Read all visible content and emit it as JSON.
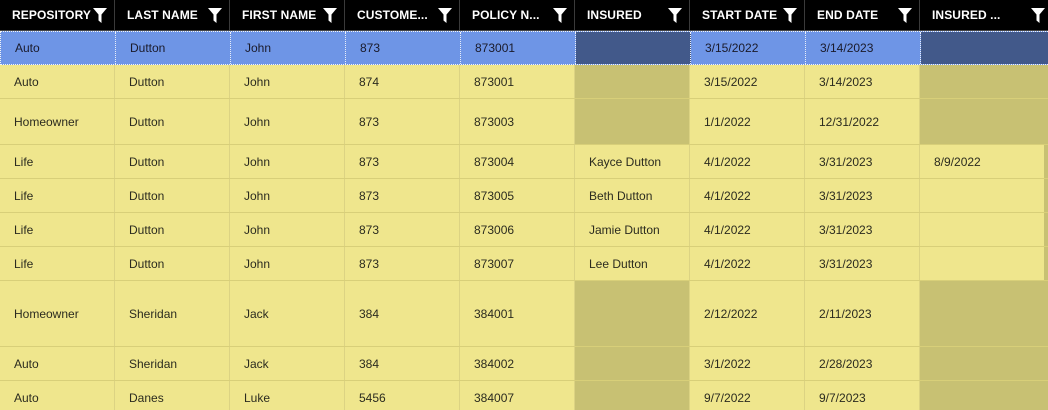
{
  "columns": [
    {
      "label": "REPOSITORY"
    },
    {
      "label": "LAST NAME"
    },
    {
      "label": "FIRST NAME"
    },
    {
      "label": "CUSTOME..."
    },
    {
      "label": "POLICY N..."
    },
    {
      "label": "INSURED"
    },
    {
      "label": "START DATE"
    },
    {
      "label": "END DATE"
    },
    {
      "label": "INSURED ..."
    }
  ],
  "rows": [
    {
      "repository": "Auto",
      "last_name": "Dutton",
      "first_name": "John",
      "customer": "873",
      "policy": "873001",
      "insured": "",
      "start": "3/15/2022",
      "end": "3/14/2023",
      "insured_date": ""
    },
    {
      "repository": "Auto",
      "last_name": "Dutton",
      "first_name": "John",
      "customer": "874",
      "policy": "873001",
      "insured": "",
      "start": "3/15/2022",
      "end": "3/14/2023",
      "insured_date": ""
    },
    {
      "repository": "Homeowner",
      "last_name": "Dutton",
      "first_name": "John",
      "customer": "873",
      "policy": "873003",
      "insured": "",
      "start": "1/1/2022",
      "end": "12/31/2022",
      "insured_date": ""
    },
    {
      "repository": "Life",
      "last_name": "Dutton",
      "first_name": "John",
      "customer": "873",
      "policy": "873004",
      "insured": "Kayce Dutton",
      "start": "4/1/2022",
      "end": "3/31/2023",
      "insured_date": "8/9/2022"
    },
    {
      "repository": "Life",
      "last_name": "Dutton",
      "first_name": "John",
      "customer": "873",
      "policy": "873005",
      "insured": "Beth Dutton",
      "start": "4/1/2022",
      "end": "3/31/2023",
      "insured_date": ""
    },
    {
      "repository": "Life",
      "last_name": "Dutton",
      "first_name": "John",
      "customer": "873",
      "policy": "873006",
      "insured": "Jamie Dutton",
      "start": "4/1/2022",
      "end": "3/31/2023",
      "insured_date": ""
    },
    {
      "repository": "Life",
      "last_name": "Dutton",
      "first_name": "John",
      "customer": "873",
      "policy": "873007",
      "insured": "Lee Dutton",
      "start": "4/1/2022",
      "end": "3/31/2023",
      "insured_date": ""
    },
    {
      "repository": "Homeowner",
      "last_name": "Sheridan",
      "first_name": "Jack",
      "customer": "384",
      "policy": "384001",
      "insured": "",
      "start": "2/12/2022",
      "end": "2/11/2023",
      "insured_date": ""
    },
    {
      "repository": "Auto",
      "last_name": "Sheridan",
      "first_name": "Jack",
      "customer": "384",
      "policy": "384002",
      "insured": "",
      "start": "3/1/2022",
      "end": "2/28/2023",
      "insured_date": ""
    },
    {
      "repository": "Auto",
      "last_name": "Danes",
      "first_name": "Luke",
      "customer": "5456",
      "policy": "384007",
      "insured": "",
      "start": "9/7/2022",
      "end": "9/7/2023",
      "insured_date": ""
    }
  ],
  "icons": {
    "filter": "filter-funnel-icon"
  },
  "colors": {
    "header_bg": "#000000",
    "row_bg": "#efe68d",
    "empty_cell": "#c8c173",
    "selected_row": "#6e95e6",
    "selected_empty": "#42598a"
  }
}
